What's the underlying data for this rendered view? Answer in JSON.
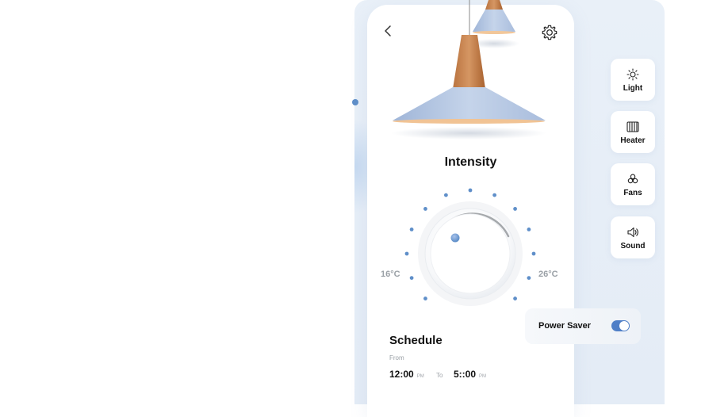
{
  "header": {
    "back_icon": "chevron-left-icon",
    "settings_icon": "gear-icon"
  },
  "intensity": {
    "title": "Intensity",
    "min_label": "16°C",
    "max_label": "26°C"
  },
  "schedule": {
    "title": "Schedule",
    "from_label": "From",
    "from_time": "12:00",
    "from_period": "PM",
    "to_label": "To",
    "to_time": "5::00",
    "to_period": "PM"
  },
  "devices": [
    {
      "label": "Light",
      "icon": "sun-icon"
    },
    {
      "label": "Heater",
      "icon": "heater-icon"
    },
    {
      "label": "Fans",
      "icon": "fan-icon"
    },
    {
      "label": "Sound",
      "icon": "speaker-icon"
    }
  ],
  "power_saver": {
    "label": "Power Saver",
    "enabled": true
  },
  "colors": {
    "accent": "#4f7fc7",
    "dot": "#5f8fc9",
    "panel_bg": "#e7eef7"
  }
}
